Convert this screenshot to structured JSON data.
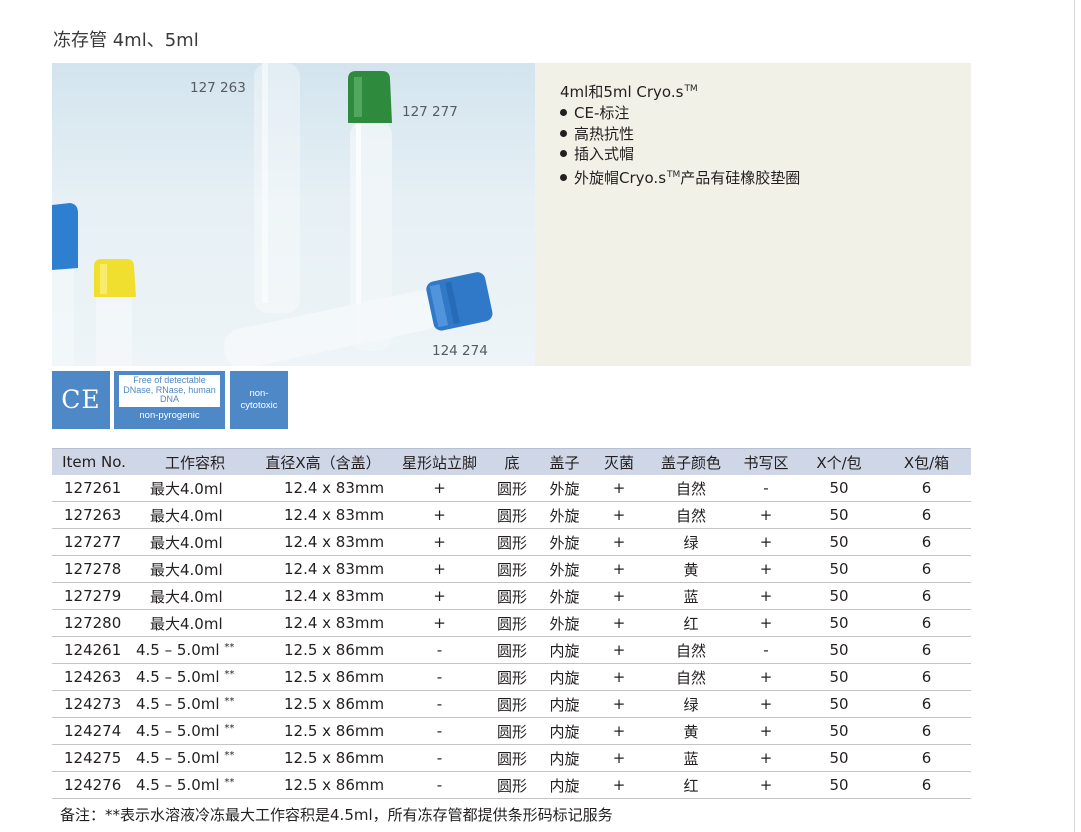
{
  "page_title": "冻存管 4ml、5ml",
  "photo": {
    "labels": [
      "127 263",
      "127 277",
      "124 274"
    ]
  },
  "features": {
    "heading_main": "4ml和5ml Cryo.s",
    "heading_sup": "TM",
    "items": [
      "CE-标注",
      "高热抗性",
      "插入式帽"
    ],
    "last_item_a": "外旋帽Cryo.s",
    "last_item_sup": "TM",
    "last_item_b": "产品有硅橡胶垫圈"
  },
  "badges": {
    "ce": "CE",
    "free_box": "Free of detectable DNase, RNase, human DNA",
    "free_under": "non-pyrogenic",
    "cyto_line1": "non-",
    "cyto_line2": "cytotoxic"
  },
  "colors": {
    "accent_blue": "#4f88c6",
    "header_bg": "#cfd6e6",
    "features_bg": "#f2f1e7"
  },
  "table": {
    "headers": [
      "Item No.",
      "工作容积",
      "直径X高（含盖）",
      "星形站立脚",
      "底",
      "盖子",
      "灭菌",
      "盖子颜色",
      "书写区",
      "X个/包",
      "X包/箱"
    ],
    "rows": [
      {
        "item": "127261",
        "volume": "最大4.0ml",
        "vol_note": "",
        "dims": "12.4 x 83mm",
        "star": "+",
        "bottom": "圆形",
        "cap": "外旋",
        "sterile": "+",
        "color": "自然",
        "write": "-",
        "per_pack": "50",
        "per_box": "6"
      },
      {
        "item": "127263",
        "volume": "最大4.0ml",
        "vol_note": "",
        "dims": "12.4 x 83mm",
        "star": "+",
        "bottom": "圆形",
        "cap": "外旋",
        "sterile": "+",
        "color": "自然",
        "write": "+",
        "per_pack": "50",
        "per_box": "6"
      },
      {
        "item": "127277",
        "volume": "最大4.0ml",
        "vol_note": "",
        "dims": "12.4 x 83mm",
        "star": "+",
        "bottom": "圆形",
        "cap": "外旋",
        "sterile": "+",
        "color": "绿",
        "write": "+",
        "per_pack": "50",
        "per_box": "6"
      },
      {
        "item": "127278",
        "volume": "最大4.0ml",
        "vol_note": "",
        "dims": "12.4 x 83mm",
        "star": "+",
        "bottom": "圆形",
        "cap": "外旋",
        "sterile": "+",
        "color": "黄",
        "write": "+",
        "per_pack": "50",
        "per_box": "6"
      },
      {
        "item": "127279",
        "volume": "最大4.0ml",
        "vol_note": "",
        "dims": "12.4 x 83mm",
        "star": "+",
        "bottom": "圆形",
        "cap": "外旋",
        "sterile": "+",
        "color": "蓝",
        "write": "+",
        "per_pack": "50",
        "per_box": "6"
      },
      {
        "item": "127280",
        "volume": "最大4.0ml",
        "vol_note": "",
        "dims": "12.4 x 83mm",
        "star": "+",
        "bottom": "圆形",
        "cap": "外旋",
        "sterile": "+",
        "color": "红",
        "write": "+",
        "per_pack": "50",
        "per_box": "6"
      },
      {
        "item": "124261",
        "volume": "4.5 – 5.0ml",
        "vol_note": "**",
        "dims": "12.5 x 86mm",
        "star": "-",
        "bottom": "圆形",
        "cap": "内旋",
        "sterile": "+",
        "color": "自然",
        "write": "-",
        "per_pack": "50",
        "per_box": "6"
      },
      {
        "item": "124263",
        "volume": "4.5 – 5.0ml",
        "vol_note": "**",
        "dims": "12.5 x 86mm",
        "star": "-",
        "bottom": "圆形",
        "cap": "内旋",
        "sterile": "+",
        "color": "自然",
        "write": "+",
        "per_pack": "50",
        "per_box": "6"
      },
      {
        "item": "124273",
        "volume": "4.5 – 5.0ml",
        "vol_note": "**",
        "dims": "12.5 x 86mm",
        "star": "-",
        "bottom": "圆形",
        "cap": "内旋",
        "sterile": "+",
        "color": "绿",
        "write": "+",
        "per_pack": "50",
        "per_box": "6"
      },
      {
        "item": "124274",
        "volume": "4.5 – 5.0ml",
        "vol_note": "**",
        "dims": "12.5 x 86mm",
        "star": "-",
        "bottom": "圆形",
        "cap": "内旋",
        "sterile": "+",
        "color": "黄",
        "write": "+",
        "per_pack": "50",
        "per_box": "6"
      },
      {
        "item": "124275",
        "volume": "4.5 – 5.0ml",
        "vol_note": "**",
        "dims": "12.5 x 86mm",
        "star": "-",
        "bottom": "圆形",
        "cap": "内旋",
        "sterile": "+",
        "color": "蓝",
        "write": "+",
        "per_pack": "50",
        "per_box": "6"
      },
      {
        "item": "124276",
        "volume": "4.5 – 5.0ml",
        "vol_note": "**",
        "dims": "12.5 x 86mm",
        "star": "-",
        "bottom": "圆形",
        "cap": "内旋",
        "sterile": "+",
        "color": "红",
        "write": "+",
        "per_pack": "50",
        "per_box": "6"
      }
    ]
  },
  "note": "备注：**表示水溶液冷冻最大工作容积是4.5ml，所有冻存管都提供条形码标记服务"
}
